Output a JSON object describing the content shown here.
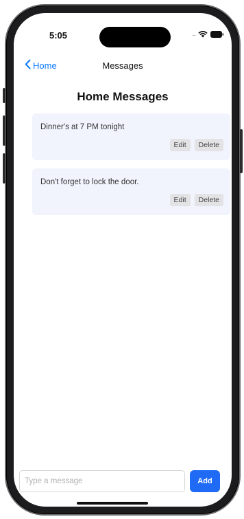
{
  "status_bar": {
    "time": "5:05",
    "signal_dots": "....",
    "icons": [
      "wifi-icon",
      "battery-icon"
    ]
  },
  "navbar": {
    "back_label": "Home",
    "title": "Messages",
    "accent_color": "#0a7aff"
  },
  "page": {
    "title": "Home Messages"
  },
  "messages": [
    {
      "text": "Dinner's at 7 PM tonight",
      "edit_label": "Edit",
      "delete_label": "Delete"
    },
    {
      "text": "Don't forget to lock the door.",
      "edit_label": "Edit",
      "delete_label": "Delete"
    }
  ],
  "composer": {
    "placeholder": "Type a message",
    "value": "",
    "add_label": "Add",
    "add_color": "#1f6bf5"
  }
}
